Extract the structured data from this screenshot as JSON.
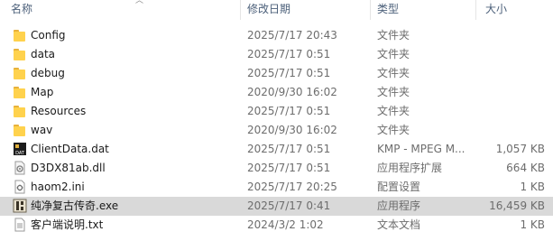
{
  "columns": {
    "name": "名称",
    "modified": "修改日期",
    "type": "类型",
    "size": "大小"
  },
  "files": [
    {
      "name": "Config",
      "modified": "2025/7/17 20:43",
      "type": "文件夹",
      "size": "",
      "icon": "folder-icon"
    },
    {
      "name": "data",
      "modified": "2025/7/17 0:51",
      "type": "文件夹",
      "size": "",
      "icon": "folder-icon"
    },
    {
      "name": "debug",
      "modified": "2025/7/17 0:51",
      "type": "文件夹",
      "size": "",
      "icon": "folder-icon"
    },
    {
      "name": "Map",
      "modified": "2020/9/30 16:02",
      "type": "文件夹",
      "size": "",
      "icon": "folder-icon"
    },
    {
      "name": "Resources",
      "modified": "2025/7/17 0:51",
      "type": "文件夹",
      "size": "",
      "icon": "folder-icon"
    },
    {
      "name": "wav",
      "modified": "2020/9/30 16:02",
      "type": "文件夹",
      "size": "",
      "icon": "folder-icon"
    },
    {
      "name": "ClientData.dat",
      "modified": "2025/7/17 0:51",
      "type": "KMP - MPEG M...",
      "size": "1,057 KB",
      "icon": "dat-file-icon",
      "icon_label": "DAT"
    },
    {
      "name": "D3DX81ab.dll",
      "modified": "2025/7/17 0:51",
      "type": "应用程序扩展",
      "size": "664 KB",
      "icon": "dll-file-icon"
    },
    {
      "name": "haom2.ini",
      "modified": "2025/7/17 20:25",
      "type": "配置设置",
      "size": "1 KB",
      "icon": "ini-file-icon"
    },
    {
      "name": "纯净复古传奇.exe",
      "modified": "2025/7/17 0:41",
      "type": "应用程序",
      "size": "16,459 KB",
      "icon": "exe-file-icon",
      "selected": true
    },
    {
      "name": "客户端说明.txt",
      "modified": "2024/3/2 1:02",
      "type": "文本文档",
      "size": "1 KB",
      "icon": "txt-file-icon"
    }
  ],
  "colors": {
    "header_text": "#4c607a",
    "selected_row": "#d9d9d9",
    "folder": "#ffd24d"
  }
}
